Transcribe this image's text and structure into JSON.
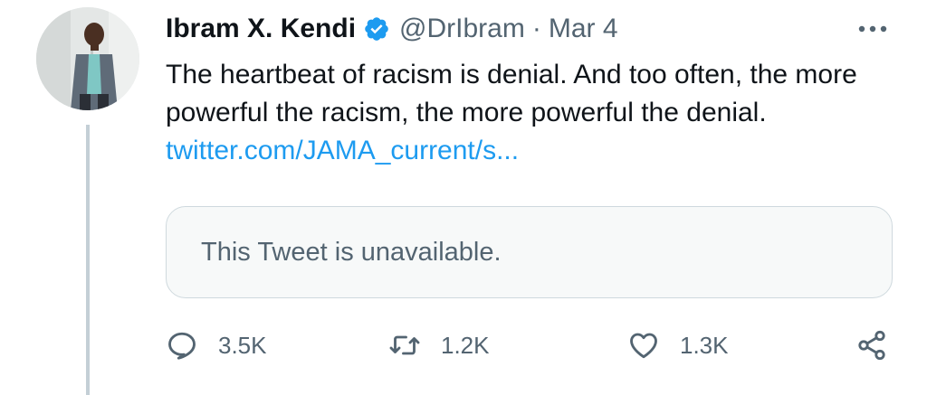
{
  "author": {
    "display_name": "Ibram X. Kendi",
    "handle": "@DrIbram",
    "separator": "·",
    "date": "Mar 4",
    "verified": true
  },
  "tweet": {
    "text": "The heartbeat of racism is denial. And too often, the more powerful the racism, the more powerful the denial. ",
    "link_text": "twitter.com/JAMA_current/s..."
  },
  "quote": {
    "text": "This Tweet is unavailable."
  },
  "actions": {
    "reply_count": "3.5K",
    "retweet_count": "1.2K",
    "like_count": "1.3K"
  },
  "icons": {
    "verified": "verified-badge-icon",
    "more": "more-options-icon",
    "reply": "reply-icon",
    "retweet": "retweet-icon",
    "like": "heart-icon",
    "share": "share-icon"
  },
  "colors": {
    "link": "#1d9bf0",
    "secondary_text": "#536471",
    "primary_text": "#0f1419",
    "verified_badge": "#1d9bf0",
    "quote_border": "#cfd9de",
    "thread_line": "#c4cfd6"
  }
}
